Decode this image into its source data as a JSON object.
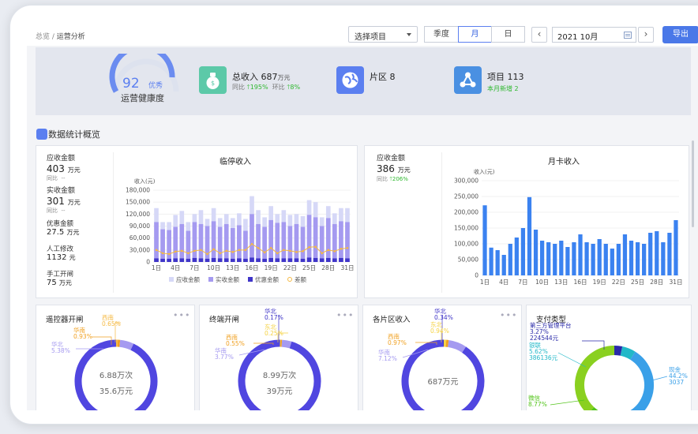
{
  "breadcrumb": {
    "root": "总览",
    "sep": " / ",
    "current": "运营分析"
  },
  "toolbar": {
    "project_select": "选择项目",
    "period_tabs": [
      "季度",
      "月",
      "日"
    ],
    "active_tab": "月",
    "prev": "‹",
    "next": "›",
    "date": "2021 10月",
    "export": "导出"
  },
  "summary": {
    "health": {
      "value": "92",
      "tag": "优秀",
      "label": "运营健康度"
    },
    "income": {
      "label": "总收入",
      "value": "687",
      "unit": "万元",
      "yoy_label": "同比",
      "yoy": "195%",
      "mom_label": "环比",
      "mom": "8%"
    },
    "area": {
      "label": "片区",
      "value": "8"
    },
    "project": {
      "label": "项目",
      "value": "113",
      "sub": "本月新增 2"
    }
  },
  "section": {
    "title": "数据统计概览"
  },
  "temp_parking": {
    "stats": [
      {
        "label": "应收金额",
        "value": "403",
        "unit": "万元",
        "sub_label": "同比",
        "sub": "--"
      },
      {
        "label": "实收金额",
        "value": "301",
        "unit": "万元",
        "sub_label": "同比",
        "sub": "--"
      },
      {
        "label": "优惠金额",
        "value": "27.5",
        "unit": "万元"
      },
      {
        "label": "人工修改",
        "value": "1132",
        "unit": "元"
      },
      {
        "label": "手工开闸",
        "value": "75",
        "unit": "万元"
      }
    ]
  },
  "monthly": {
    "label": "应收金额",
    "value": "386",
    "unit": "万元",
    "sub_label": "同比",
    "sub": "206%"
  },
  "chart_data": [
    {
      "type": "bar",
      "title": "临停收入",
      "ylabel": "收入(元)",
      "ylim": [
        0,
        180000
      ],
      "yticks": [
        "0",
        "30,000",
        "60,000",
        "90,000",
        "120,000",
        "150,000",
        "180,000"
      ],
      "categories": [
        "1日",
        "2日",
        "3日",
        "4日",
        "5日",
        "6日",
        "7日",
        "8日",
        "9日",
        "10日",
        "11日",
        "12日",
        "13日",
        "14日",
        "15日",
        "16日",
        "17日",
        "18日",
        "19日",
        "20日",
        "21日",
        "22日",
        "23日",
        "24日",
        "25日",
        "26日",
        "27日",
        "28日",
        "29日",
        "30日",
        "31日"
      ],
      "xticks": [
        "1日",
        "4日",
        "7日",
        "10日",
        "13日",
        "16日",
        "19日",
        "22日",
        "25日",
        "28日",
        "31日"
      ],
      "legend": [
        "应收金额",
        "实收金额",
        "优惠金额",
        "差额"
      ],
      "colors": {
        "receivable": "#d6d8f7",
        "actual": "#a59af0",
        "discount": "#3f35c8",
        "diff": "#f5b942"
      },
      "series": [
        {
          "name": "应收金额",
          "values": [
            135000,
            100000,
            100000,
            118000,
            128000,
            100000,
            120000,
            130000,
            108000,
            135000,
            110000,
            120000,
            110000,
            122000,
            108000,
            165000,
            130000,
            112000,
            140000,
            120000,
            130000,
            118000,
            120000,
            115000,
            155000,
            150000,
            112000,
            140000,
            122000,
            135000,
            135000
          ]
        },
        {
          "name": "实收金额",
          "values": [
            100000,
            82000,
            80000,
            88000,
            95000,
            78000,
            100000,
            95000,
            90000,
            102000,
            88000,
            95000,
            85000,
            92000,
            78000,
            120000,
            95000,
            88000,
            105000,
            98000,
            100000,
            90000,
            95000,
            88000,
            118000,
            112000,
            90000,
            110000,
            95000,
            102000,
            100000
          ]
        },
        {
          "name": "优惠金额",
          "values": [
            9000,
            8000,
            8000,
            9000,
            9000,
            8000,
            10000,
            9000,
            8000,
            10000,
            9000,
            9000,
            8000,
            9000,
            8000,
            11000,
            9000,
            8000,
            10000,
            9000,
            9000,
            9000,
            9000,
            8000,
            11000,
            10000,
            9000,
            10000,
            9000,
            10000,
            9000
          ]
        },
        {
          "name": "差额",
          "values": [
            30000,
            22000,
            20000,
            26000,
            28000,
            22000,
            28000,
            30000,
            20000,
            32000,
            22000,
            28000,
            25000,
            30000,
            30000,
            45000,
            35000,
            24000,
            35000,
            22000,
            30000,
            28000,
            25000,
            27000,
            37000,
            38000,
            22000,
            30000,
            27000,
            33000,
            35000
          ]
        }
      ]
    },
    {
      "type": "bar",
      "title": "月卡收入",
      "ylabel": "收入(元)",
      "ylim": [
        0,
        300000
      ],
      "yticks": [
        "0",
        "50,000",
        "100,000",
        "150,000",
        "200,000",
        "250,000",
        "300,000"
      ],
      "categories": [
        "1日",
        "2日",
        "3日",
        "4日",
        "5日",
        "6日",
        "7日",
        "8日",
        "9日",
        "10日",
        "11日",
        "12日",
        "13日",
        "14日",
        "15日",
        "16日",
        "17日",
        "18日",
        "19日",
        "20日",
        "21日",
        "22日",
        "23日",
        "24日",
        "25日",
        "26日",
        "27日",
        "28日",
        "29日",
        "30日",
        "31日"
      ],
      "xticks": [
        "1日",
        "4日",
        "7日",
        "10日",
        "13日",
        "16日",
        "19日",
        "22日",
        "25日",
        "28日",
        "31日"
      ],
      "color": "#3b82f0",
      "values": [
        222000,
        88000,
        80000,
        65000,
        100000,
        120000,
        150000,
        248000,
        145000,
        110000,
        105000,
        100000,
        110000,
        90000,
        105000,
        130000,
        105000,
        100000,
        115000,
        100000,
        85000,
        100000,
        130000,
        110000,
        105000,
        100000,
        135000,
        140000,
        105000,
        135000,
        175000
      ]
    },
    {
      "type": "pie",
      "title": "遥控器开闸",
      "center": [
        "6.88万次",
        "35.6万元"
      ],
      "slices": [
        {
          "name": "西南",
          "pct": "0.65%",
          "value": 0.65,
          "color": "#f5b942"
        },
        {
          "name": "华南",
          "pct": "0.93%",
          "value": 0.93,
          "color": "#f0a020"
        },
        {
          "name": "华北",
          "pct": "5.38%",
          "value": 5.38,
          "color": "#a59af0"
        },
        {
          "name": "other",
          "value": 93.04,
          "color": "#5046e0"
        }
      ]
    },
    {
      "type": "pie",
      "title": "终端开闸",
      "center": [
        "8.99万次",
        "39万元"
      ],
      "slices": [
        {
          "name": "华北",
          "pct": "0.17%",
          "value": 0.17,
          "color": "#3f35c8"
        },
        {
          "name": "东北",
          "pct": "0.25%",
          "value": 0.25,
          "color": "#f5d242"
        },
        {
          "name": "西南",
          "pct": "0.55%",
          "value": 0.55,
          "color": "#f0a020"
        },
        {
          "name": "华南",
          "pct": "3.77%",
          "value": 3.77,
          "color": "#a59af0"
        },
        {
          "name": "other",
          "value": 95.26,
          "color": "#5046e0"
        }
      ]
    },
    {
      "type": "pie",
      "title": "各片区收入",
      "center": [
        "687万元"
      ],
      "slices": [
        {
          "name": "华北",
          "pct": "0.34%",
          "value": 0.34,
          "color": "#3f35c8"
        },
        {
          "name": "东北",
          "pct": "0.94%",
          "value": 0.94,
          "color": "#f5d242"
        },
        {
          "name": "西南",
          "pct": "0.97%",
          "value": 0.97,
          "color": "#f0a020"
        },
        {
          "name": "华南",
          "pct": "7.12%",
          "value": 7.12,
          "color": "#a59af0"
        },
        {
          "name": "other",
          "value": 90.63,
          "color": "#5046e0"
        }
      ]
    },
    {
      "type": "pie",
      "title": "支付类型",
      "slices": [
        {
          "name": "第三方管理平台",
          "pct": "3.27%",
          "amount": "224544元",
          "value": 3.27,
          "color": "#2a2aa8"
        },
        {
          "name": "银联",
          "pct": "5.62%",
          "amount": "386136元",
          "value": 5.62,
          "color": "#22b8c8"
        },
        {
          "name": "现金",
          "pct": "44.2%",
          "amount": "3037",
          "value": 44.2,
          "color": "#3aa0e8"
        },
        {
          "name": "微信",
          "pct": "8.77%",
          "value": 8.77,
          "color": "#52c41a"
        },
        {
          "name": "other",
          "value": 38.14,
          "color": "#8ad020"
        }
      ]
    }
  ]
}
